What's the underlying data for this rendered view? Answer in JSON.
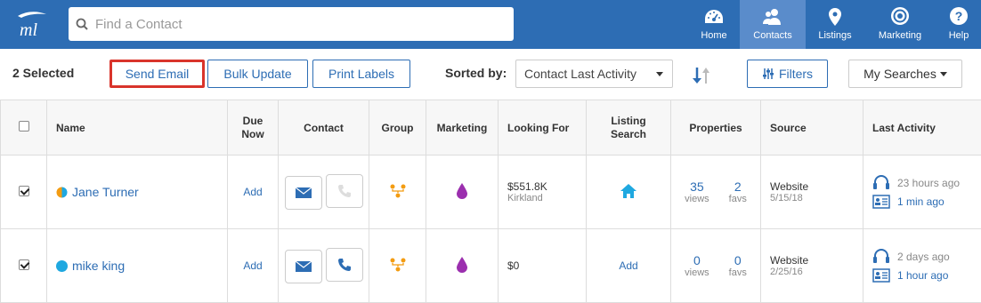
{
  "search": {
    "placeholder": "Find a Contact"
  },
  "nav": [
    {
      "label": "Home",
      "icon": "dashboard-icon"
    },
    {
      "label": "Contacts",
      "icon": "contacts-icon",
      "active": true
    },
    {
      "label": "Listings",
      "icon": "map-pin-icon"
    },
    {
      "label": "Marketing",
      "icon": "target-icon"
    },
    {
      "label": "Help",
      "icon": "help-icon"
    }
  ],
  "toolbar": {
    "selected_text": "2 Selected",
    "send_email_label": "Send Email",
    "bulk_update_label": "Bulk Update",
    "print_labels_label": "Print Labels",
    "sorted_by_label": "Sorted by:",
    "sort_value": "Contact Last Activity",
    "filters_label": "Filters",
    "my_searches_label": "My Searches"
  },
  "table": {
    "headers": {
      "name": "Name",
      "due_now_1": "Due",
      "due_now_2": "Now",
      "contact": "Contact",
      "group": "Group",
      "marketing": "Marketing",
      "looking_for": "Looking For",
      "listing_search_1": "Listing",
      "listing_search_2": "Search",
      "properties": "Properties",
      "source": "Source",
      "last_activity": "Last Activity"
    },
    "rows": [
      {
        "checked": true,
        "name": "Jane Turner",
        "due": "Add",
        "looking_price": "$551.8K",
        "looking_city": "Kirkland",
        "listing_search": "",
        "views": "35",
        "views_label": "views",
        "favs": "2",
        "favs_label": "favs",
        "source": "Website",
        "source_date": "5/15/18",
        "activity_1": "23 hours ago",
        "activity_2": "1 min ago"
      },
      {
        "checked": true,
        "name": "mike king",
        "due": "Add",
        "looking_price": "$0",
        "looking_city": "",
        "listing_search": "Add",
        "views": "0",
        "views_label": "views",
        "favs": "0",
        "favs_label": "favs",
        "source": "Website",
        "source_date": "2/25/16",
        "activity_1": "2 days ago",
        "activity_2": "1 hour ago"
      }
    ]
  },
  "colors": {
    "brand": "#2d6db4",
    "highlight": "#d9342b",
    "group_icon": "#f39c12",
    "marketing_drop": "#9b2fae",
    "home_icon": "#1fa8e0"
  }
}
